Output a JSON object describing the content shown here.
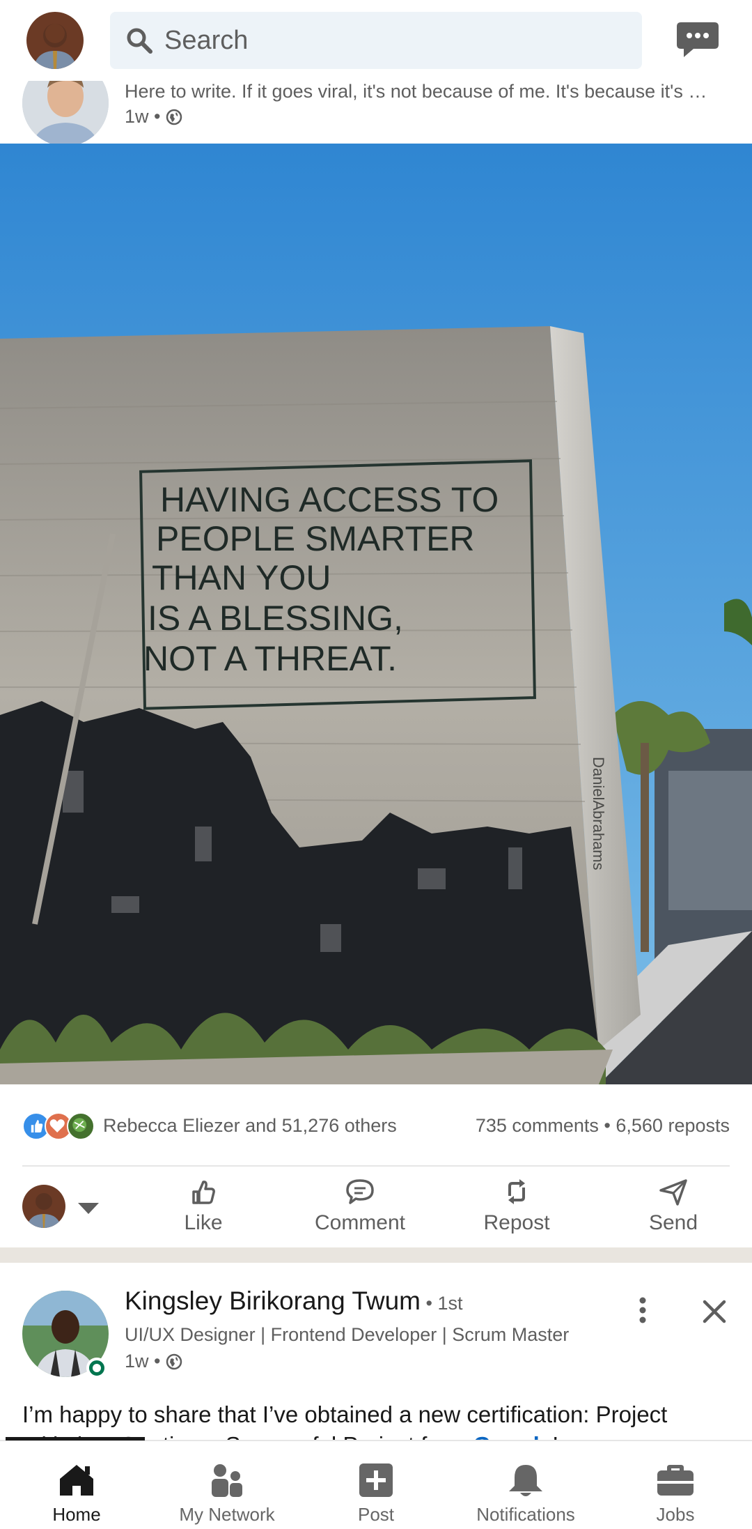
{
  "topbar": {
    "search_placeholder": "Search",
    "icons": [
      "profile-avatar",
      "search-icon",
      "messaging-icon"
    ]
  },
  "post1": {
    "subtitle": "Here to write. If it goes viral, it's not because of me. It's because it's …",
    "time": "1w •",
    "image": {
      "quote_lines": [
        "HAVING ACCESS TO",
        "PEOPLE SMARTER",
        "THAN YOU",
        "IS A BLESSING,",
        "NOT A THREAT."
      ],
      "watermark": "DanielAbrahams"
    },
    "reactions_text": "Rebecca Eliezer and 51,276 others",
    "counts_text": "735 comments • 6,560 reposts",
    "actions": {
      "like": "Like",
      "comment": "Comment",
      "repost": "Repost",
      "send": "Send"
    }
  },
  "post2": {
    "author": "Kingsley Birikorang Twum",
    "degree": " • 1st",
    "headline": "UI/UX Designer | Frontend Developer | Scrum Master",
    "time": "1w •",
    "body_line1": "I’m happy to share that I’ve obtained a new certification: Project",
    "body_line2_start": "Initiation: Starting a Successful Project from ",
    "body_link": "Google",
    "body_line2_end": "!"
  },
  "nav": {
    "home": "Home",
    "network": "My Network",
    "post": "Post",
    "notifications": "Notifications",
    "jobs": "Jobs",
    "active": "Home"
  },
  "colors": {
    "accent_link": "#0a66c2",
    "online_green": "#01754f",
    "search_bg": "#edf3f8"
  }
}
